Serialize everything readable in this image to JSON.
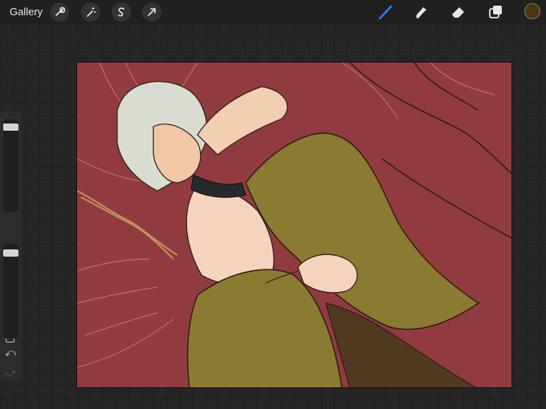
{
  "topbar": {
    "gallery_label": "Gallery",
    "left_tools": [
      "wrench-icon",
      "magic-wand-icon",
      "selection-icon",
      "transform-arrow-icon"
    ],
    "right_tools": [
      "brush-icon",
      "smudge-icon",
      "eraser-icon",
      "layers-icon"
    ],
    "active_tool": "brush",
    "active_tool_color": "#2f7df6",
    "current_color": "#4a3710"
  },
  "sidebar": {
    "brush_size_level": 0.1,
    "opacity_level": 0.1,
    "undo_icon": "undo-icon",
    "redo_icon": "redo-icon"
  },
  "canvas": {
    "background_color": "#913b41",
    "artwork": "illustration"
  }
}
